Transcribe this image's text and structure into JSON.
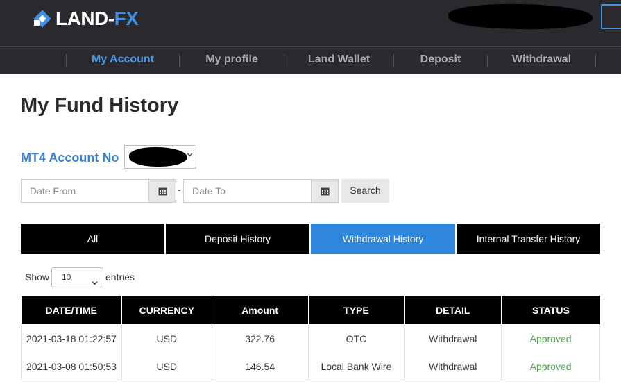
{
  "brand": {
    "logo_text_a": "LAND-",
    "logo_text_b": "FX",
    "accent": "#3f8fe0"
  },
  "nav": {
    "items": [
      {
        "label": "My Account",
        "active": true
      },
      {
        "label": "My profile",
        "active": false
      },
      {
        "label": "Land Wallet",
        "active": false
      },
      {
        "label": "Deposit",
        "active": false
      },
      {
        "label": "Withdrawal",
        "active": false
      }
    ]
  },
  "page": {
    "title": "My Fund History"
  },
  "filters": {
    "account_label": "MT4 Account No",
    "date_from_placeholder": "Date From",
    "date_to_placeholder": "Date To",
    "separator": "-",
    "search_label": "Search"
  },
  "tabs": [
    {
      "label": "All",
      "active": false
    },
    {
      "label": "Deposit History",
      "active": false
    },
    {
      "label": "Withdrawal History",
      "active": true
    },
    {
      "label": "Internal Transfer History",
      "active": false
    }
  ],
  "entries": {
    "show_label": "Show",
    "value": "10",
    "suffix_label": "entries"
  },
  "table": {
    "columns": [
      "DATE/TIME",
      "CURRENCY",
      "Amount",
      "TYPE",
      "DETAIL",
      "STATUS"
    ],
    "rows": [
      [
        "2021-03-18 01:22:57",
        "USD",
        "322.76",
        "OTC",
        "Withdrawal",
        "Approved"
      ],
      [
        "2021-03-08 01:50:53",
        "USD",
        "146.54",
        "Local Bank Wire",
        "Withdrawal",
        "Approved"
      ]
    ]
  },
  "colors": {
    "header_bg": "#2a2a2e",
    "active_tab": "#2f86dd",
    "status_approved": "#4e9a4e",
    "account_label": "#3a82d0"
  }
}
